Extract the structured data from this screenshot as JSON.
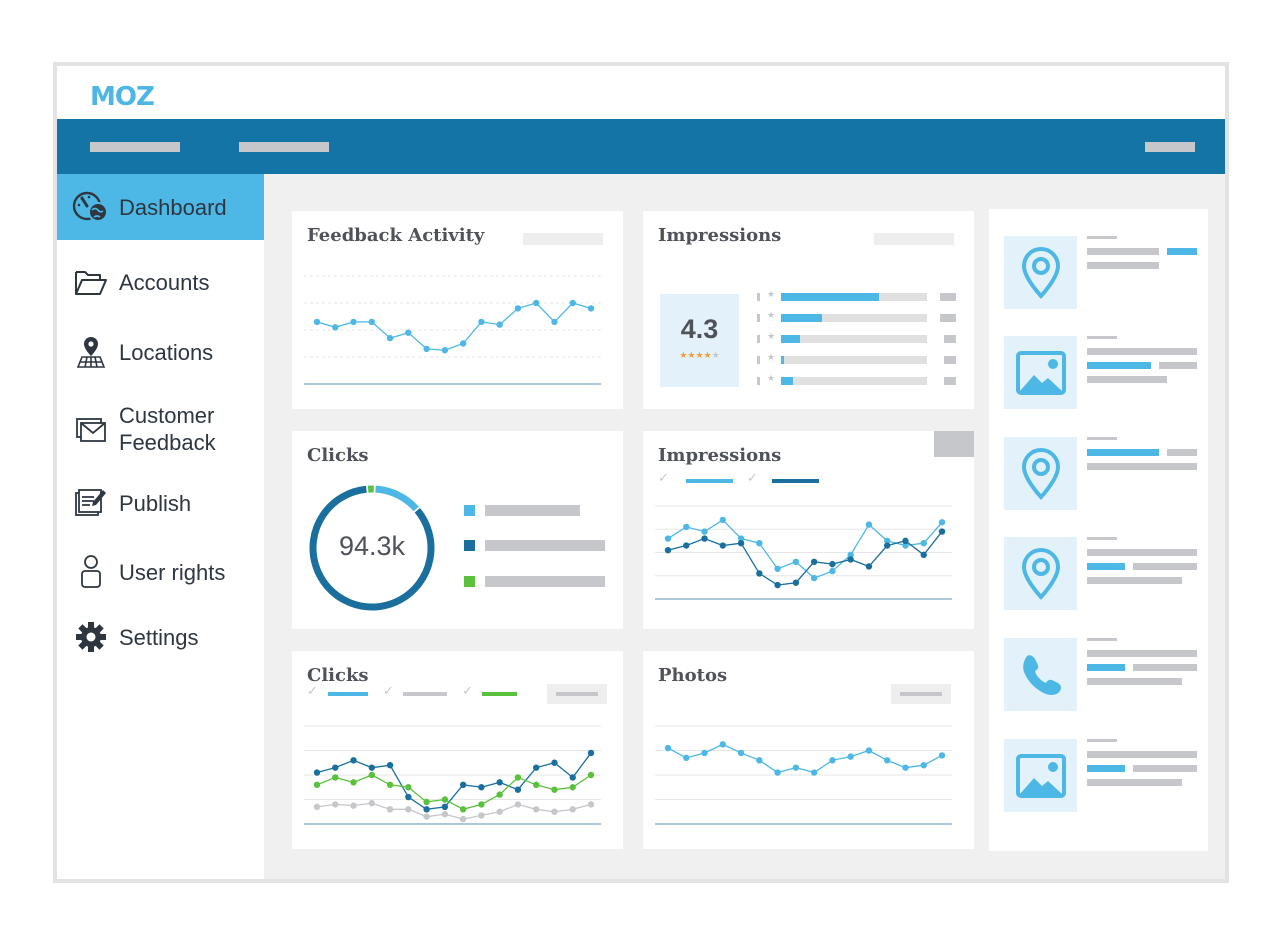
{
  "app": {
    "brand": "MOZ",
    "colors": {
      "nav": "#1474a6",
      "accent": "#4db8e6",
      "dark_blue": "#1a6f9e",
      "green": "#5ac13d",
      "placeholder": "#c6c7cb",
      "icon_bg": "#e3f2fa",
      "star": "#f0a03b"
    }
  },
  "sidebar": {
    "items": [
      {
        "label": "Dashboard",
        "icon": "dashboard-gauge-globe-icon",
        "active": true
      },
      {
        "label": "Accounts",
        "icon": "folder-open-icon",
        "active": false
      },
      {
        "label": "Locations",
        "icon": "map-pin-grid-icon",
        "active": false
      },
      {
        "label": "Customer Feedback",
        "icon": "envelope-icon",
        "active": false
      },
      {
        "label": "Publish",
        "icon": "edit-document-icon",
        "active": false
      },
      {
        "label": "User rights",
        "icon": "user-icon",
        "active": false
      },
      {
        "label": "Settings",
        "icon": "gear-icon",
        "active": false
      }
    ]
  },
  "cards": {
    "feedback_activity": {
      "title": "Feedback Activity"
    },
    "impressions_rating": {
      "title": "Impressions",
      "rating": "4.3",
      "stars": "★★★★",
      "stars_off": "★"
    },
    "clicks_donut": {
      "title": "Clicks",
      "total": "94.3k"
    },
    "impressions_lines": {
      "title": "Impressions"
    },
    "clicks_lines": {
      "title": "Clicks"
    },
    "photos": {
      "title": "Photos"
    }
  },
  "feed": {
    "items": [
      {
        "icon": "map-pin-icon"
      },
      {
        "icon": "image-icon"
      },
      {
        "icon": "map-pin-icon"
      },
      {
        "icon": "map-pin-icon"
      },
      {
        "icon": "phone-icon"
      },
      {
        "icon": "image-icon"
      }
    ]
  },
  "chart_data": [
    {
      "id": "feedback_activity",
      "type": "line",
      "title": "Feedback Activity",
      "ylim": [
        0,
        4
      ],
      "grid": true,
      "series": [
        {
          "name": "activity",
          "color": "#4db8e6",
          "values": [
            2.3,
            2.1,
            2.3,
            2.3,
            1.7,
            1.9,
            1.3,
            1.25,
            1.5,
            2.3,
            2.2,
            2.8,
            3.0,
            2.3,
            3.0,
            2.8
          ]
        }
      ]
    },
    {
      "id": "impressions_rating",
      "type": "bar",
      "title": "Impressions rating distribution",
      "categories": [
        "5",
        "4",
        "3",
        "2",
        "1"
      ],
      "values": [
        0.67,
        0.28,
        0.13,
        0.02,
        0.08
      ],
      "ylim": [
        0,
        1
      ]
    },
    {
      "id": "clicks_donut",
      "type": "pie",
      "title": "Clicks",
      "center_label": "94.3k",
      "series": [
        {
          "name": "light-blue",
          "color": "#4db8e6",
          "value": 13
        },
        {
          "name": "dark-blue",
          "color": "#1a6f9e",
          "value": 85
        },
        {
          "name": "green",
          "color": "#5ac13d",
          "value": 2
        }
      ]
    },
    {
      "id": "impressions_lines",
      "type": "line",
      "title": "Impressions",
      "ylim": [
        0,
        4
      ],
      "grid": true,
      "series": [
        {
          "name": "light",
          "color": "#4db8e6",
          "values": [
            2.6,
            3.1,
            2.9,
            3.4,
            2.6,
            2.4,
            1.3,
            1.6,
            0.9,
            1.2,
            1.9,
            3.2,
            2.5,
            2.3,
            2.4,
            3.3
          ]
        },
        {
          "name": "dark",
          "color": "#1a6f9e",
          "values": [
            2.1,
            2.3,
            2.6,
            2.3,
            2.4,
            1.1,
            0.6,
            0.7,
            1.6,
            1.5,
            1.7,
            1.4,
            2.3,
            2.5,
            1.9,
            2.9
          ]
        }
      ]
    },
    {
      "id": "clicks_lines",
      "type": "line",
      "title": "Clicks",
      "ylim": [
        0,
        4
      ],
      "grid": true,
      "series": [
        {
          "name": "dark-blue",
          "color": "#1a6f9e",
          "values": [
            2.1,
            2.3,
            2.6,
            2.3,
            2.4,
            1.1,
            0.6,
            0.7,
            1.6,
            1.5,
            1.7,
            1.4,
            2.3,
            2.5,
            1.9,
            2.9
          ]
        },
        {
          "name": "green",
          "color": "#5ac13d",
          "values": [
            1.6,
            1.9,
            1.7,
            2.0,
            1.6,
            1.5,
            0.9,
            1.0,
            0.6,
            0.8,
            1.2,
            1.9,
            1.6,
            1.4,
            1.5,
            2.0
          ]
        },
        {
          "name": "gray",
          "color": "#c6c7cb",
          "values": [
            0.7,
            0.8,
            0.75,
            0.85,
            0.6,
            0.6,
            0.3,
            0.4,
            0.2,
            0.35,
            0.5,
            0.8,
            0.6,
            0.5,
            0.6,
            0.8
          ]
        }
      ]
    },
    {
      "id": "photos",
      "type": "line",
      "title": "Photos",
      "ylim": [
        0,
        4
      ],
      "grid": true,
      "series": [
        {
          "name": "photos",
          "color": "#4db8e6",
          "values": [
            3.1,
            2.7,
            2.9,
            3.25,
            2.9,
            2.6,
            2.1,
            2.3,
            2.1,
            2.6,
            2.75,
            3.0,
            2.6,
            2.3,
            2.4,
            2.8
          ]
        }
      ]
    }
  ]
}
